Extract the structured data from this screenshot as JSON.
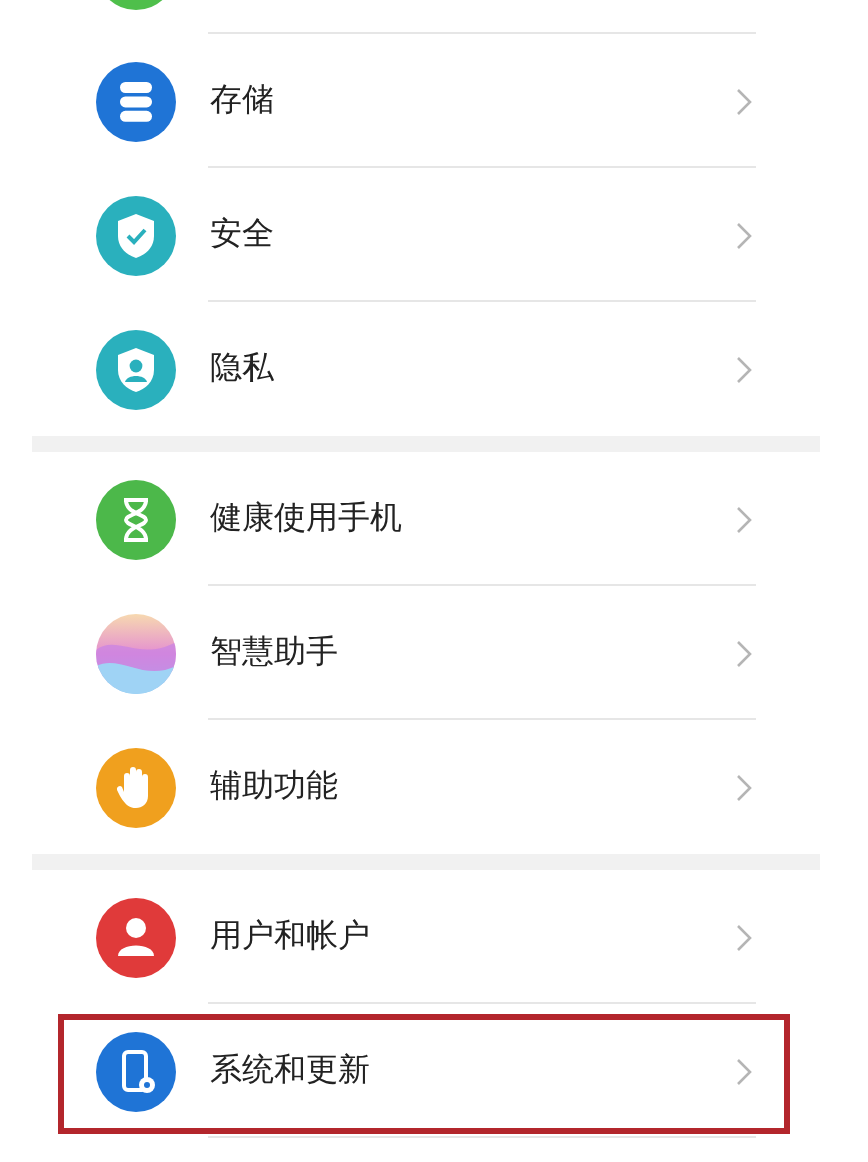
{
  "groups": [
    {
      "items": [
        {
          "label": "存储",
          "highlighted": false
        },
        {
          "label": "安全",
          "highlighted": false
        },
        {
          "label": "隐私",
          "highlighted": false
        }
      ]
    },
    {
      "items": [
        {
          "label": "健康使用手机",
          "highlighted": false
        },
        {
          "label": "智慧助手",
          "highlighted": false
        },
        {
          "label": "辅助功能",
          "highlighted": false
        }
      ]
    },
    {
      "items": [
        {
          "label": "用户和帐户",
          "highlighted": false
        },
        {
          "label": "系统和更新",
          "highlighted": true
        }
      ]
    }
  ]
}
